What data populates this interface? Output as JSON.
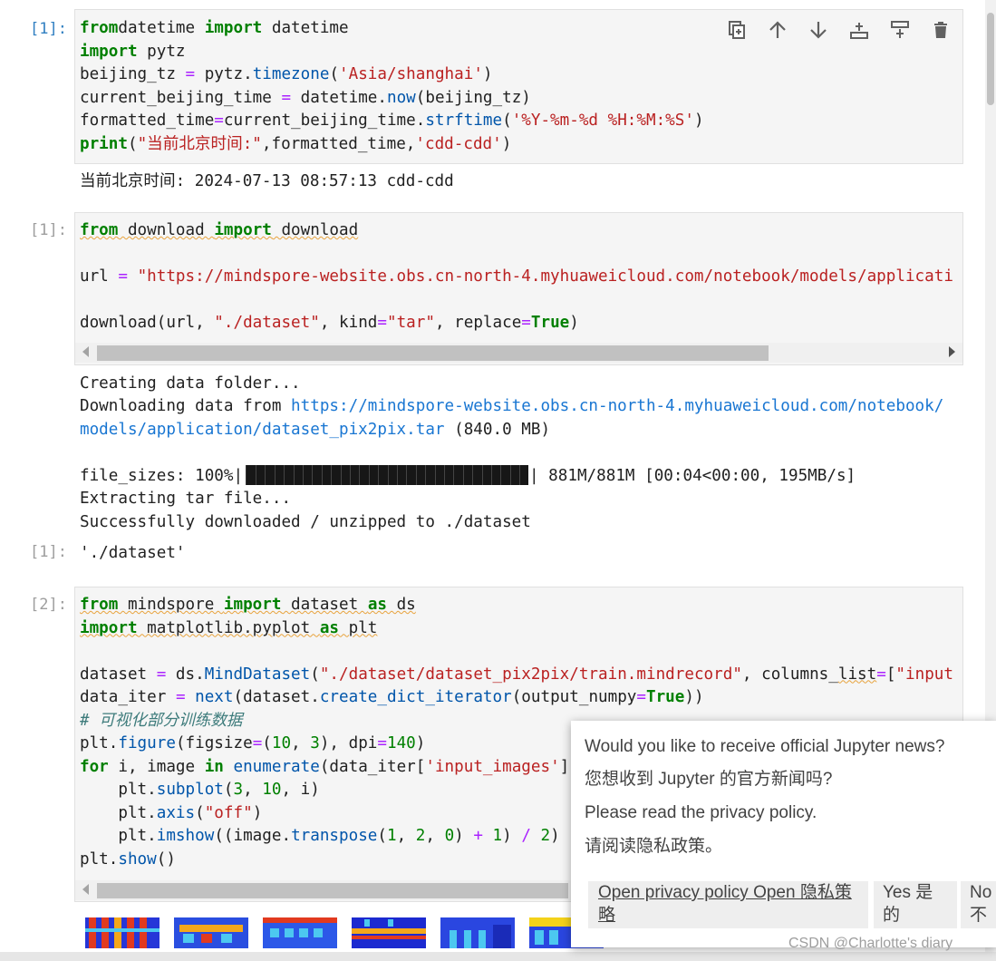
{
  "cell1": {
    "prompt": "[1]:",
    "lines": [
      [
        [
          "kw",
          "from"
        ],
        [
          "",
          "datetime "
        ],
        [
          "kw",
          "import"
        ],
        [
          "",
          " datetime"
        ]
      ],
      [
        [
          "kw",
          "import"
        ],
        [
          "",
          " pytz"
        ]
      ],
      [
        [
          "",
          "beijing_tz "
        ],
        [
          "op",
          "="
        ],
        [
          "",
          " pytz."
        ],
        [
          "fn",
          "timezone"
        ],
        [
          "",
          "("
        ],
        [
          "str",
          "'Asia/shanghai'"
        ],
        [
          "",
          ")"
        ]
      ],
      [
        [
          "",
          "current_beijing_time "
        ],
        [
          "op",
          "="
        ],
        [
          "",
          " datetime."
        ],
        [
          "fn",
          "now"
        ],
        [
          "",
          "(beijing_tz)"
        ]
      ],
      [
        [
          "",
          "formatted_time"
        ],
        [
          "op",
          "="
        ],
        [
          "",
          "current_beijing_time."
        ],
        [
          "fn",
          "strftime"
        ],
        [
          "",
          "("
        ],
        [
          "str",
          "'%Y-%m-%d %H:%M:%S'"
        ],
        [
          "",
          ")"
        ]
      ],
      [
        [
          "kw",
          "print"
        ],
        [
          "",
          "("
        ],
        [
          "str",
          "\"当前北京时间:\""
        ],
        [
          "",
          ",formatted_time,"
        ],
        [
          "str",
          "'cdd-cdd'"
        ],
        [
          "",
          ")"
        ]
      ]
    ],
    "output": "当前北京时间: 2024-07-13 08:57:13 cdd-cdd"
  },
  "cell2": {
    "prompt": "[1]:",
    "lines": [
      [
        [
          "kw sq",
          "from"
        ],
        [
          "sq",
          " download "
        ],
        [
          "kw sq",
          "import"
        ],
        [
          "sq",
          " download"
        ]
      ],
      [
        [
          "",
          ""
        ]
      ],
      [
        [
          "",
          "url "
        ],
        [
          "op",
          "="
        ],
        [
          "",
          " "
        ],
        [
          "str",
          "\"https://mindspore-website.obs.cn-north-4.myhuaweicloud.com/notebook/models/applicati"
        ]
      ],
      [
        [
          "",
          ""
        ]
      ],
      [
        [
          "",
          "download(url, "
        ],
        [
          "str",
          "\"./dataset\""
        ],
        [
          "",
          ", kind"
        ],
        [
          "op",
          "="
        ],
        [
          "str",
          "\"tar\""
        ],
        [
          "",
          ", replace"
        ],
        [
          "op",
          "="
        ],
        [
          "kw",
          "True"
        ],
        [
          "",
          ")"
        ]
      ]
    ],
    "output_lines": [
      "Creating data folder...",
      "Downloading data from "
    ],
    "link_part1": "https://mindspore-website.obs.cn-north-4.myhuaweicloud.com/notebook/",
    "link_part2": "models/application/dataset_pix2pix.tar",
    "link_suffix": " (840.0 MB)",
    "progress_prefix": "file_sizes: 100%|",
    "progress_fraction": 1.0,
    "progress_suffix": "| 881M/881M [00:04<00:00, 195MB/s]",
    "extract_line": "Extracting tar file...",
    "done_line": "Successfully downloaded / unzipped to ./dataset",
    "result_prompt": "[1]:",
    "result": "'./dataset'"
  },
  "cell3": {
    "prompt": "[2]:",
    "lines": [
      [
        [
          "kw sq",
          "from"
        ],
        [
          "sq",
          " mindspore "
        ],
        [
          "kw sq",
          "import"
        ],
        [
          "sq",
          " dataset "
        ],
        [
          "kw sq",
          "as"
        ],
        [
          "sq",
          " ds"
        ]
      ],
      [
        [
          "kw sq",
          "import"
        ],
        [
          "sq",
          " matplotlib.pyplot "
        ],
        [
          "kw sq",
          "as"
        ],
        [
          "sq",
          " plt"
        ]
      ],
      [
        [
          "",
          ""
        ]
      ],
      [
        [
          "",
          "dataset "
        ],
        [
          "op",
          "="
        ],
        [
          "",
          " ds."
        ],
        [
          "fn",
          "MindDataset"
        ],
        [
          "",
          "("
        ],
        [
          "str",
          "\"./dataset/dataset_pix2pix/train.mindrecord\""
        ],
        [
          "",
          ", columns_"
        ],
        [
          "sq",
          "list"
        ],
        [
          "op",
          "="
        ],
        [
          "",
          "["
        ],
        [
          "str",
          "\"input"
        ]
      ],
      [
        [
          "",
          "data_iter "
        ],
        [
          "op",
          "="
        ],
        [
          "",
          " "
        ],
        [
          "fn",
          "next"
        ],
        [
          "",
          "(dataset."
        ],
        [
          "fn",
          "create_dict_iterator"
        ],
        [
          "",
          "(output_numpy"
        ],
        [
          "op",
          "="
        ],
        [
          "kw",
          "True"
        ],
        [
          "",
          "))"
        ]
      ],
      [
        [
          "cmt",
          "# 可视化部分训练数据"
        ]
      ],
      [
        [
          "",
          "plt."
        ],
        [
          "fn",
          "figure"
        ],
        [
          "",
          "(figsize"
        ],
        [
          "op",
          "="
        ],
        [
          "",
          "("
        ],
        [
          "num",
          "10"
        ],
        [
          "",
          ", "
        ],
        [
          "num",
          "3"
        ],
        [
          "",
          "), dpi"
        ],
        [
          "op",
          "="
        ],
        [
          "num",
          "140"
        ],
        [
          "",
          ")"
        ]
      ],
      [
        [
          "kw",
          "for"
        ],
        [
          "",
          " i, image "
        ],
        [
          "kw",
          "in"
        ],
        [
          "",
          " "
        ],
        [
          "fn",
          "enumerate"
        ],
        [
          "",
          "(data_iter["
        ],
        [
          "str",
          "'input_images'"
        ],
        [
          "",
          "]"
        ]
      ],
      [
        [
          "",
          "    plt."
        ],
        [
          "fn",
          "subplot"
        ],
        [
          "",
          "("
        ],
        [
          "num",
          "3"
        ],
        [
          "",
          ", "
        ],
        [
          "num",
          "10"
        ],
        [
          "",
          ", i)"
        ]
      ],
      [
        [
          "",
          "    plt."
        ],
        [
          "fn",
          "axis"
        ],
        [
          "",
          "("
        ],
        [
          "str",
          "\"off\""
        ],
        [
          "",
          ")"
        ]
      ],
      [
        [
          "",
          "    plt."
        ],
        [
          "fn",
          "imshow"
        ],
        [
          "",
          "((image."
        ],
        [
          "fn",
          "transpose"
        ],
        [
          "",
          "("
        ],
        [
          "num",
          "1"
        ],
        [
          "",
          ", "
        ],
        [
          "num",
          "2"
        ],
        [
          "",
          ", "
        ],
        [
          "num",
          "0"
        ],
        [
          "",
          ") "
        ],
        [
          "op",
          "+"
        ],
        [
          "",
          " "
        ],
        [
          "num",
          "1"
        ],
        [
          "",
          ") "
        ],
        [
          "op",
          "/"
        ],
        [
          "",
          " "
        ],
        [
          "num",
          "2"
        ],
        [
          "",
          ")"
        ]
      ],
      [
        [
          "",
          "plt."
        ],
        [
          "fn",
          "show"
        ],
        [
          "",
          "()"
        ]
      ]
    ]
  },
  "toolbar": {
    "icons": [
      "duplicate-icon",
      "move-up-icon",
      "move-down-icon",
      "insert-above-icon",
      "insert-below-icon",
      "delete-icon"
    ]
  },
  "notification": {
    "line1": "Would you like to receive official Jupyter news?",
    "line2": "您想收到 Jupyter 的官方新闻吗?",
    "line3": "Please read the privacy policy.",
    "line4": "请阅读隐私政策。",
    "btn_privacy": "Open privacy policy Open 隐私策略",
    "btn_yes": "Yes 是的",
    "btn_no": "No 不"
  },
  "watermark": "CSDN @Charlotte's diary",
  "colors": {
    "active_prompt": "#307fc1",
    "keyword": "#008000",
    "string": "#ba2121",
    "link": "#1976d2"
  }
}
